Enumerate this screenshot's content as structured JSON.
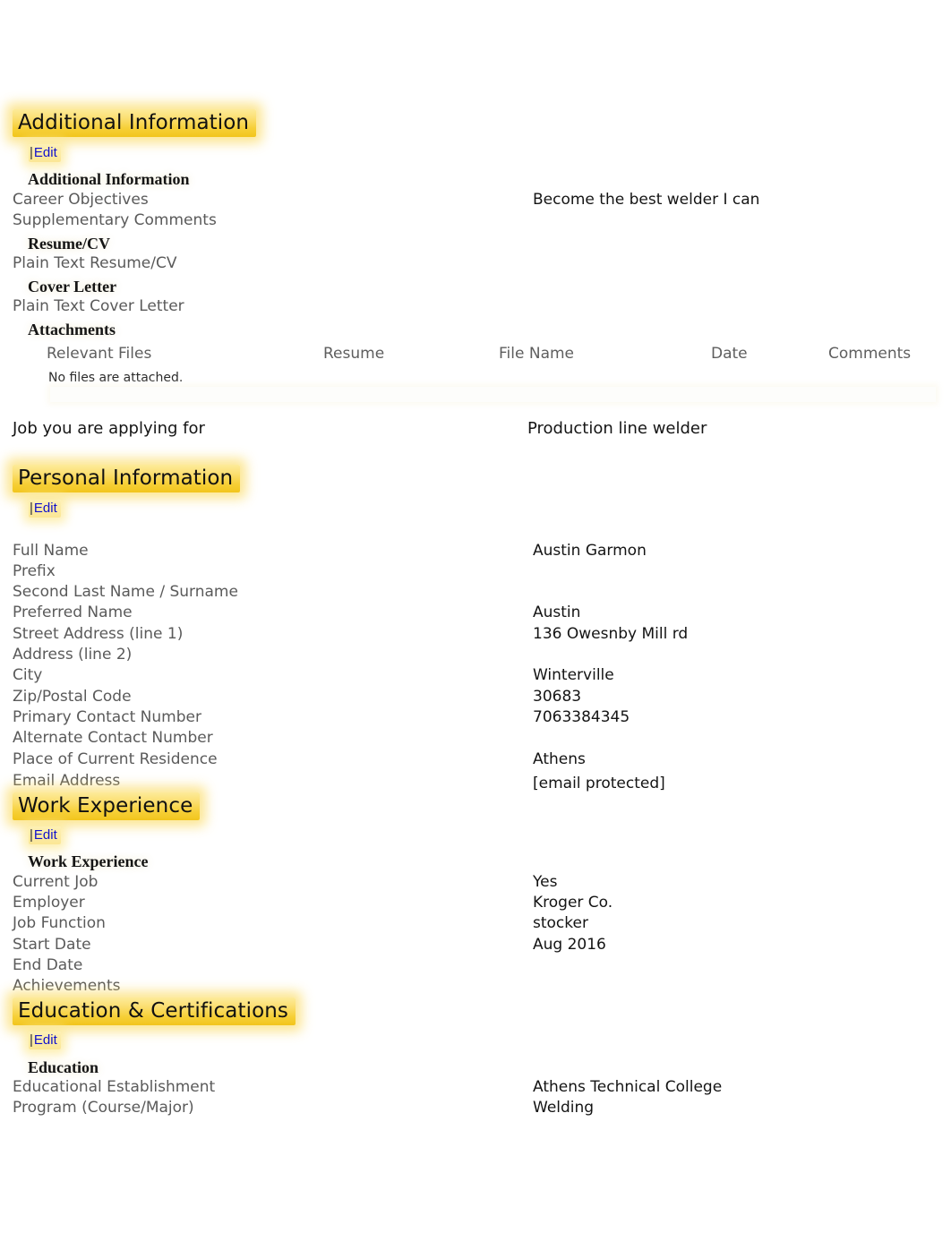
{
  "sections": {
    "additional_information": {
      "heading": "Additional Information",
      "edit_label": "Edit",
      "pipe": "|",
      "groups": {
        "additional_information": {
          "title": "Additional Information",
          "fields": [
            {
              "label": "Career Objectives",
              "value": "Become the best welder I can"
            },
            {
              "label": "Supplementary Comments",
              "value": ""
            }
          ]
        },
        "resume_cv": {
          "title": "Resume/CV",
          "fields": [
            {
              "label": "Plain Text Resume/CV",
              "value": ""
            }
          ]
        },
        "cover_letter": {
          "title": "Cover Letter",
          "fields": [
            {
              "label": "Plain Text Cover Letter",
              "value": ""
            }
          ]
        },
        "attachments": {
          "title": "Attachments",
          "table": {
            "columns": [
              "Relevant Files",
              "Resume",
              "File Name",
              "Date",
              "Comments"
            ],
            "empty_message": "No files are attached."
          }
        }
      }
    },
    "applying_for": {
      "label": "Job you are applying for",
      "value": "Production line welder"
    },
    "personal_information": {
      "heading": "Personal Information",
      "edit_label": "Edit",
      "pipe": "|",
      "fields": [
        {
          "label": "Full Name",
          "value": "Austin Garmon"
        },
        {
          "label": "Prefix",
          "value": ""
        },
        {
          "label": "Second Last Name / Surname",
          "value": ""
        },
        {
          "label": "Preferred Name",
          "value": "Austin"
        },
        {
          "label": "Street Address (line 1)",
          "value": "136 Owesnby Mill rd"
        },
        {
          "label": "Address (line 2)",
          "value": ""
        },
        {
          "label": "City",
          "value": "Winterville"
        },
        {
          "label": "Zip/Postal Code",
          "value": "30683"
        },
        {
          "label": "Primary Contact Number",
          "value": "7063384345"
        },
        {
          "label": "Alternate Contact Number",
          "value": ""
        },
        {
          "label": "Place of Current Residence",
          "value": "Athens"
        },
        {
          "label": "Email Address",
          "value": "[email protected]"
        }
      ]
    },
    "work_experience": {
      "heading": "Work Experience",
      "edit_label": "Edit",
      "pipe": "|",
      "group_title": "Work Experience",
      "fields": [
        {
          "label": "Current Job",
          "value": "Yes"
        },
        {
          "label": "Employer",
          "value": "Kroger Co."
        },
        {
          "label": "Job Function",
          "value": "stocker"
        },
        {
          "label": "Start Date",
          "value": "Aug 2016"
        },
        {
          "label": "End Date",
          "value": ""
        },
        {
          "label": "Achievements",
          "value": ""
        }
      ]
    },
    "education_certifications": {
      "heading": "Education & Certifications",
      "edit_label": "Edit",
      "pipe": "|",
      "group_title": "Education",
      "fields": [
        {
          "label": "Educational Establishment",
          "value": "Athens Technical College"
        },
        {
          "label": "Program (Course/Major)",
          "value": "Welding"
        }
      ]
    }
  },
  "colors": {
    "highlight_gold": "#f6cf36",
    "highlight_pale": "#fdeb9a",
    "link_blue": "#1111cc",
    "label_gray": "#5a5a5a",
    "value_black": "#141414"
  }
}
